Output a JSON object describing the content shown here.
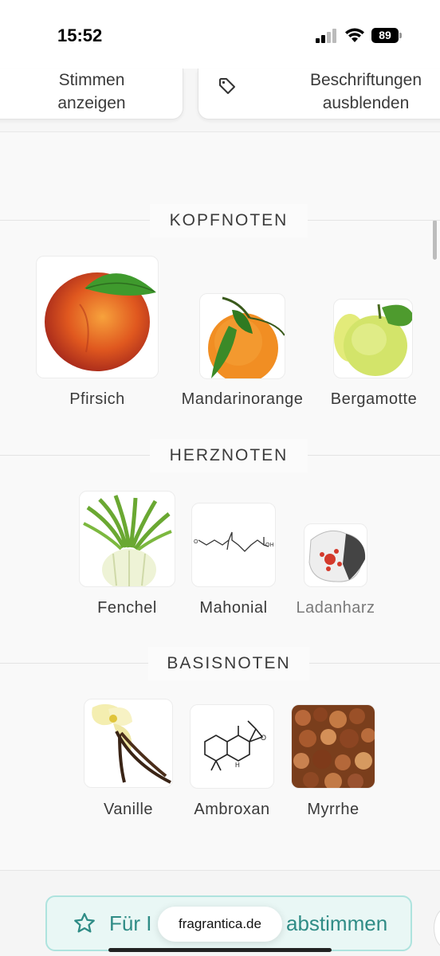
{
  "status": {
    "time": "15:52",
    "battery": "89"
  },
  "toolbar": {
    "votes_line1": "Stimmen",
    "votes_line2": "anzeigen",
    "labels_line1": "Beschriftungen",
    "labels_line2": "ausblenden"
  },
  "sections": {
    "top": {
      "title": "KOPFNOTEN",
      "notes": [
        {
          "label": "Pfirsich",
          "icon": "peach-image"
        },
        {
          "label": "Mandarinorange",
          "icon": "mandarin-image"
        },
        {
          "label": "Bergamotte",
          "icon": "bergamot-image"
        }
      ]
    },
    "heart": {
      "title": "HERZNOTEN",
      "notes": [
        {
          "label": "Fenchel",
          "icon": "fennel-image"
        },
        {
          "label": "Mahonial",
          "icon": "molecule-image"
        },
        {
          "label": "Ladanharz",
          "icon": "labdanum-image"
        }
      ]
    },
    "base": {
      "title": "BASISNOTEN",
      "notes": [
        {
          "label": "Vanille",
          "icon": "vanilla-image"
        },
        {
          "label": "Ambroxan",
          "icon": "molecule-image"
        },
        {
          "label": "Myrrhe",
          "icon": "myrrh-image"
        }
      ]
    }
  },
  "vote_button": {
    "label_start": "Für I",
    "label_end": "abstimmen"
  },
  "browser": {
    "url": "fragrantica.de"
  },
  "colors": {
    "accent": "#2f8c86",
    "accent_bg": "#e9f7f5",
    "accent_border": "#aee3de"
  }
}
